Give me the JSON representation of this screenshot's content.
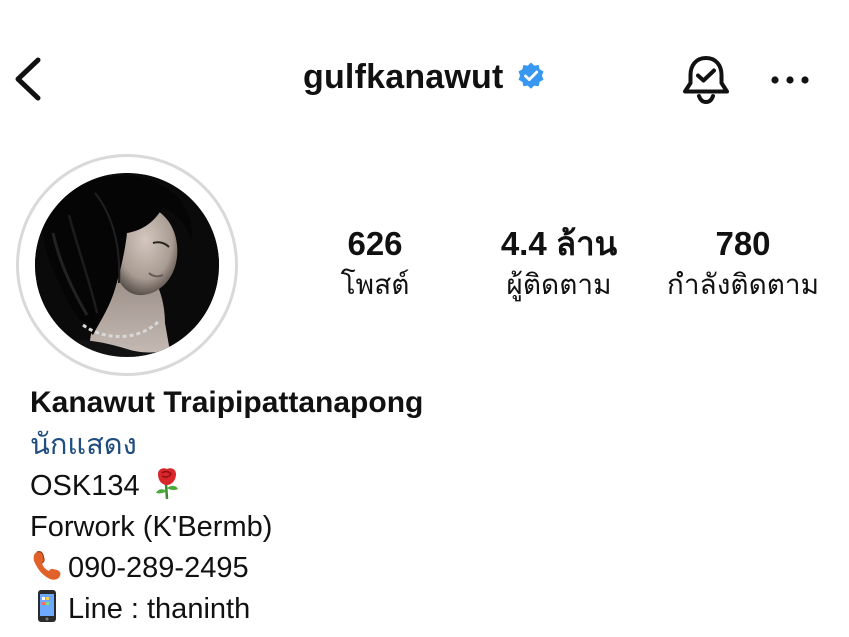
{
  "header": {
    "username": "gulfkanawut",
    "back_icon": "chevron-left-icon",
    "verified_icon": "verified-badge-icon",
    "verified_color": "#3897f0",
    "notify_icon": "bell-check-icon",
    "more_icon": "more-horizontal-icon"
  },
  "profile": {
    "avatar": "profile-photo",
    "stats": [
      {
        "value": "626",
        "label": "โพสต์"
      },
      {
        "value": "4.4 ล้าน",
        "label": "ผู้ติดตาม"
      },
      {
        "value": "780",
        "label": "กำลังติดตาม"
      }
    ]
  },
  "bio": {
    "full_name": "Kanawut Traipipattanapong",
    "category": "นักแสดง",
    "category_color": "#1f4d7f",
    "lines": [
      {
        "text": "OSK134",
        "emoji": "rose-emoji"
      },
      {
        "text": "Forwork (K'Bermb)"
      },
      {
        "text": "090-289-2495",
        "emoji": "telephone-emoji"
      },
      {
        "text": "Line : thaninth",
        "emoji": "mobile-phone-emoji"
      }
    ]
  }
}
